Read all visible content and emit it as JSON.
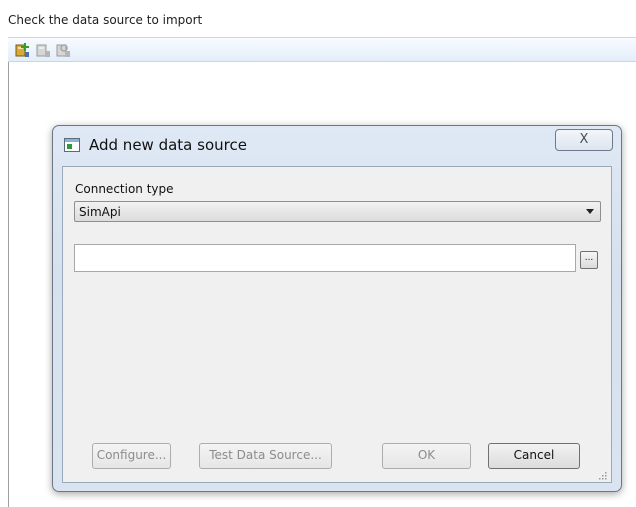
{
  "instruction": "Check the data source to import",
  "toolbar": {
    "icons": [
      "add-source-icon",
      "edit-source-icon",
      "remove-source-icon"
    ]
  },
  "dialog": {
    "title": "Add new data source",
    "close_label": "X",
    "connection_type_label": "Connection type",
    "connection_type_value": "SimApi",
    "path_value": "",
    "browse_label": "...",
    "buttons": {
      "configure": "Configure...",
      "test": "Test Data Source...",
      "ok": "OK",
      "cancel": "Cancel"
    }
  },
  "colors": {
    "dialog_frame": "#d5e1ee",
    "client_bg": "#f0f0f0",
    "toolbar_bg": "#e3eef9"
  }
}
